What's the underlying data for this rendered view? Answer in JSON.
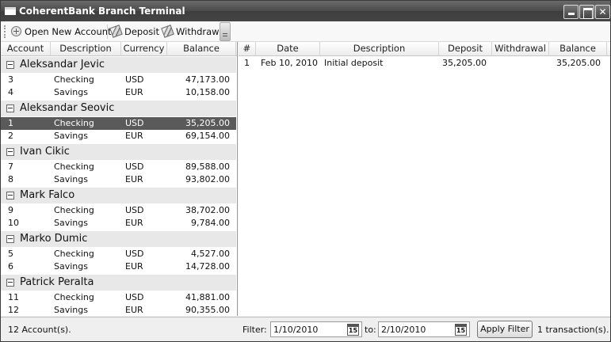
{
  "window": {
    "title": "CoherentBank Branch Terminal"
  },
  "toolbar": {
    "open_label": "Open New Account",
    "deposit_label": "Deposit",
    "withdraw_label": "Withdraw"
  },
  "accounts_table": {
    "columns": [
      "Account",
      "Description",
      "Currency",
      "Balance"
    ],
    "groups": [
      {
        "name": "Aleksandar Jevic",
        "rows": [
          {
            "account": "3",
            "description": "Checking",
            "currency": "USD",
            "balance": "47,173.00"
          },
          {
            "account": "4",
            "description": "Savings",
            "currency": "EUR",
            "balance": "10,158.00"
          }
        ]
      },
      {
        "name": "Aleksandar Seovic",
        "rows": [
          {
            "account": "1",
            "description": "Checking",
            "currency": "USD",
            "balance": "35,205.00",
            "selected": true
          },
          {
            "account": "2",
            "description": "Savings",
            "currency": "EUR",
            "balance": "69,154.00"
          }
        ]
      },
      {
        "name": "Ivan Cikic",
        "rows": [
          {
            "account": "7",
            "description": "Checking",
            "currency": "USD",
            "balance": "89,588.00"
          },
          {
            "account": "8",
            "description": "Savings",
            "currency": "EUR",
            "balance": "93,802.00"
          }
        ]
      },
      {
        "name": "Mark Falco",
        "rows": [
          {
            "account": "9",
            "description": "Checking",
            "currency": "USD",
            "balance": "38,702.00"
          },
          {
            "account": "10",
            "description": "Savings",
            "currency": "EUR",
            "balance": "9,784.00"
          }
        ]
      },
      {
        "name": "Marko Dumic",
        "rows": [
          {
            "account": "5",
            "description": "Checking",
            "currency": "USD",
            "balance": "4,527.00"
          },
          {
            "account": "6",
            "description": "Savings",
            "currency": "EUR",
            "balance": "14,728.00"
          }
        ]
      },
      {
        "name": "Patrick Peralta",
        "rows": [
          {
            "account": "11",
            "description": "Checking",
            "currency": "USD",
            "balance": "41,881.00"
          },
          {
            "account": "12",
            "description": "Savings",
            "currency": "EUR",
            "balance": "90,355.00"
          }
        ]
      }
    ]
  },
  "transactions_table": {
    "columns": [
      "#",
      "Date",
      "Description",
      "Deposit",
      "Withdrawal",
      "Balance"
    ],
    "rows": [
      {
        "num": "1",
        "date": "Feb 10, 2010",
        "description": "Initial deposit",
        "deposit": "35,205.00",
        "withdrawal": "",
        "balance": "35,205.00"
      }
    ]
  },
  "status": {
    "accounts_count": "12  Account(s).",
    "filter_label": "Filter:",
    "from_date": "1/10/2010",
    "to_label": "to:",
    "to_date": "2/10/2010",
    "calendar_day": "15",
    "apply_label": "Apply Filter",
    "transactions_count": "1  transaction(s)."
  },
  "colors": {
    "selected_row": "#5a5a5a",
    "group_header": "#e8e8e8",
    "title_bar": "#4a4a4a"
  }
}
